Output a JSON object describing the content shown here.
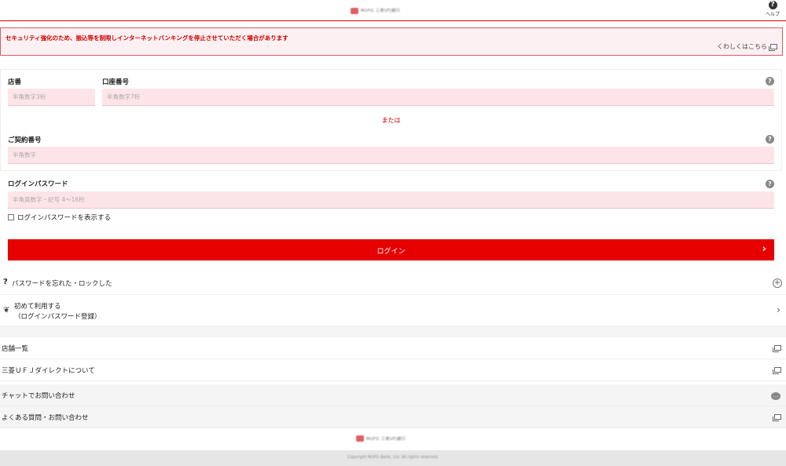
{
  "header": {
    "brand_text": "MUFG 三菱UFJ銀行",
    "help_label": "ヘルプ"
  },
  "notice": {
    "text": "セキュリティ強化のため、振込等を制限しインターネットバンキングを停止させていただく場合があります",
    "link_label": "くわしくはこちら"
  },
  "form": {
    "branch_label": "店番",
    "branch_placeholder": "半角数字3桁",
    "account_label": "口座番号",
    "account_placeholder": "半角数字7桁",
    "or_text": "または",
    "contract_label": "ご契約番号",
    "contract_placeholder": "半角数字",
    "password_label": "ログインパスワード",
    "password_placeholder": "半角英数字・記号 4〜16桁",
    "show_password_label": "ログインパスワードを表示する",
    "login_button": "ログイン"
  },
  "links": {
    "forgot": "パスワードを忘れた・ロックした",
    "first_use_line1": "初めて利用する",
    "first_use_line2": "（ログインパスワード登録）",
    "branch_list": "店舗一覧",
    "about_direct": "三菱ＵＦＪダイレクトについて",
    "chat_inquiry": "チャットでお問い合わせ",
    "faq": "よくある質問・お問い合わせ"
  },
  "footer": {
    "brand_text": "MUFG 三菱UFJ銀行",
    "copyright": "Copyright MUFG Bank, Ltd. All rights reserved."
  },
  "colors": {
    "accent": "#e60000",
    "field_bg": "#fde4e8",
    "notice_bg": "#fdf0f2"
  }
}
